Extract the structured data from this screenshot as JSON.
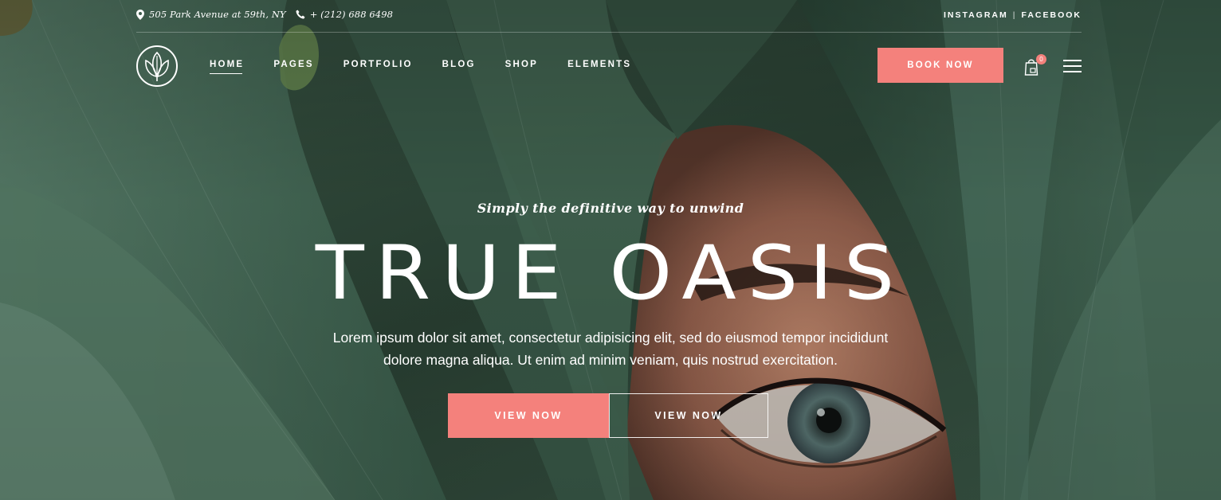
{
  "topbar": {
    "address": "505 Park Avenue at 59th, NY",
    "phone": "+ (212) 688 6498",
    "social": [
      "INSTAGRAM",
      "FACEBOOK"
    ],
    "social_separator": "|"
  },
  "nav": {
    "logo_icon": "leaf-emblem-icon",
    "items": [
      "HOME",
      "PAGES",
      "PORTFOLIO",
      "BLOG",
      "SHOP",
      "ELEMENTS"
    ],
    "active_item": "HOME",
    "book_label": "BOOK NOW",
    "cart_count": "0"
  },
  "hero": {
    "tagline": "Simply the definitive way to unwind",
    "headline": "TRUE OASIS",
    "description_lines": [
      "Lorem ipsum dolor sit amet, consectetur adipisicing elit, sed do eiusmod tempor incididunt",
      "dolore magna aliqua. Ut enim ad minim veniam, quis nostrud exercitation."
    ],
    "primary_cta": "VIEW NOW",
    "secondary_cta": "VIEW NOW"
  },
  "colors": {
    "accent": "#f4817c",
    "background_foliage": "#2f4a3c",
    "text": "#ffffff"
  }
}
